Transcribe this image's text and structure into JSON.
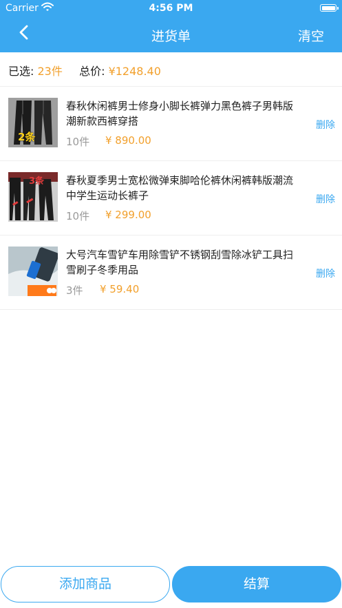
{
  "status_bar": {
    "carrier": "Carrier",
    "time": "4:56 PM"
  },
  "header": {
    "title": "进货单",
    "clear_label": "清空",
    "background": "#3aa8f0"
  },
  "summary": {
    "selected_label": "已选:",
    "selected_count": "23件",
    "total_label": "总价:",
    "total_value": "¥1248.40"
  },
  "products": [
    {
      "name": "春秋休闲裤男士修身小脚长裤弹力黑色裤子男韩版潮新款西裤穿搭",
      "qty": "10件",
      "price": "¥ 890.00",
      "delete_label": "删除",
      "image_badge": "2条"
    },
    {
      "name": "春秋夏季男士宽松微弹束脚哈伦裤休闲裤韩版潮流中学生运动长裤子",
      "qty": "10件",
      "price": "¥ 299.00",
      "delete_label": "删除",
      "image_badge": "3条"
    },
    {
      "name": "大号汽车雪铲车用除雪铲不锈钢刮雪除冰铲工具扫雪刷子冬季用品",
      "qty": "3件",
      "price": "¥ 59.40",
      "delete_label": "删除"
    }
  ],
  "footer": {
    "add_label": "添加商品",
    "checkout_label": "结算"
  },
  "colors": {
    "accent_blue": "#3aa8f0",
    "price_orange": "#f2a02c"
  }
}
